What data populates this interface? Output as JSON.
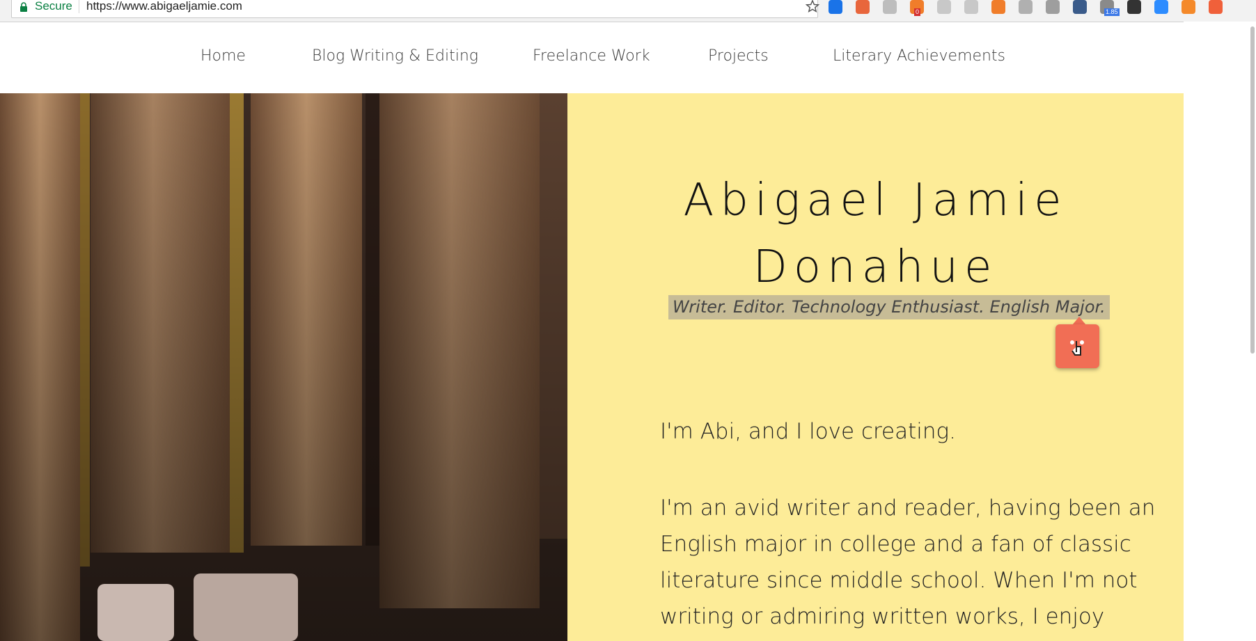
{
  "browser": {
    "secure_label": "Secure",
    "url": "https://www.abigaeljamie.com",
    "extensions": [
      {
        "name": "circle-ext-icon",
        "color": "#1a73e8"
      },
      {
        "name": "hubspot-sales-icon",
        "color": "#e8663c"
      },
      {
        "name": "json-ext-icon",
        "color": "#bdbdbd"
      },
      {
        "name": "phone-ext-icon",
        "color": "#f07d2a",
        "badge": "0"
      },
      {
        "name": "mail-ext-icon",
        "color": "#c8c8c8"
      },
      {
        "name": "chrome-ext-icon",
        "color": "#c8c8c8"
      },
      {
        "name": "hubspot-orange-icon",
        "color": "#f07d2a"
      },
      {
        "name": "hubspot-gray-icon",
        "color": "#b0b0b0"
      },
      {
        "name": "gray-square-ext-icon",
        "color": "#9e9e9e"
      },
      {
        "name": "pen-ext-icon",
        "color": "#3a5b8a"
      },
      {
        "name": "speed-ext-icon",
        "color": "#8a8a8a",
        "badge": "1.85"
      },
      {
        "name": "hand-ext-icon",
        "color": "#333333"
      },
      {
        "name": "zoom-ext-icon",
        "color": "#2d8cff"
      },
      {
        "name": "orange-square-ext-icon",
        "color": "#f4892a"
      },
      {
        "name": "hubspot-round-icon",
        "color": "#f0603a"
      }
    ]
  },
  "nav": {
    "items": [
      {
        "label": "Home"
      },
      {
        "label": "Blog Writing & Editing"
      },
      {
        "label": "Freelance Work"
      },
      {
        "label": "Projects"
      },
      {
        "label": "Literary Achievements"
      }
    ]
  },
  "hero": {
    "title_line1": "Abigael Jamie",
    "title_line2": "Donahue",
    "tagline": "Writer. Editor. Technology Enthusiast. English Major.",
    "intro": "I'm Abi, and I love creating.",
    "bio_lines": [
      "I'm an avid writer and reader, having been an",
      "English major in college and a fan of classic",
      "literature since middle school. When I'm not",
      "writing or admiring written works, I enjoy"
    ]
  },
  "colors": {
    "panel": "#fdec98",
    "highlight": "#c7bc96",
    "share_button": "#f16e55"
  }
}
